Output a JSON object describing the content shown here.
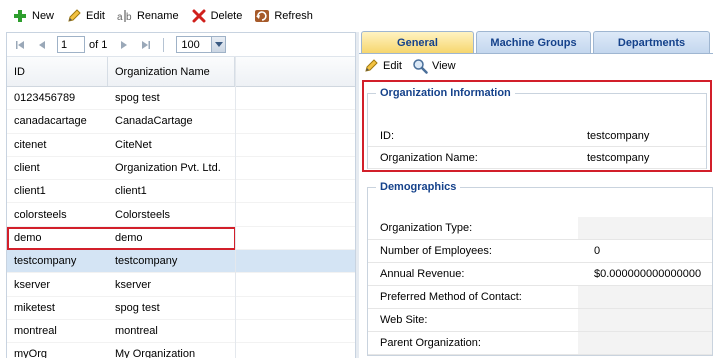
{
  "toolbar": {
    "new": "New",
    "edit": "Edit",
    "rename": "Rename",
    "delete": "Delete",
    "refresh": "Refresh"
  },
  "pager": {
    "page": "1",
    "of": "of 1",
    "page_size": "100"
  },
  "grid": {
    "headers": [
      "ID",
      "Organization Name"
    ],
    "rows": [
      {
        "id": "0123456789",
        "name": "spog test"
      },
      {
        "id": "canadacartage",
        "name": "CanadaCartage"
      },
      {
        "id": "citenet",
        "name": "CiteNet"
      },
      {
        "id": "client",
        "name": "Organization Pvt. Ltd."
      },
      {
        "id": "client1",
        "name": "client1"
      },
      {
        "id": "colorsteels",
        "name": "Colorsteels"
      },
      {
        "id": "demo",
        "name": "demo"
      },
      {
        "id": "testcompany",
        "name": "testcompany"
      },
      {
        "id": "kserver",
        "name": "kserver"
      },
      {
        "id": "miketest",
        "name": "spog test"
      },
      {
        "id": "montreal",
        "name": "montreal"
      },
      {
        "id": "myOrg",
        "name": "My Organization"
      }
    ]
  },
  "tabs": [
    "General",
    "Machine Groups",
    "Departments"
  ],
  "subbar": {
    "edit": "Edit",
    "view": "View"
  },
  "org_info": {
    "legend": "Organization Information",
    "rows": [
      {
        "label": "ID:",
        "value": "testcompany"
      },
      {
        "label": "Organization Name:",
        "value": "testcompany"
      }
    ]
  },
  "demographics": {
    "legend": "Demographics",
    "rows": [
      {
        "label": "Organization Type:",
        "value": ""
      },
      {
        "label": "Number of Employees:",
        "value": "0"
      },
      {
        "label": "Annual Revenue:",
        "value": "$0.000000000000000"
      },
      {
        "label": "Preferred Method of Contact:",
        "value": ""
      },
      {
        "label": "Web Site:",
        "value": ""
      },
      {
        "label": "Parent Organization:",
        "value": ""
      }
    ]
  },
  "colors": {
    "accent": "#15428b",
    "highlight": "#d21f2a",
    "selected_row": "#d4e4f4",
    "active_tab": "#f6d66e"
  }
}
